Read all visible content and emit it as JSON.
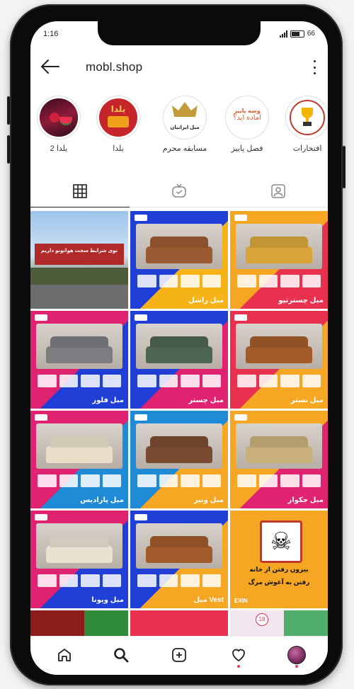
{
  "status": {
    "time": "1:16",
    "battery": "66"
  },
  "profile": {
    "username": "mobl.shop"
  },
  "highlights": [
    {
      "label": "افتخارات",
      "inner": "",
      "bg": "#ffffff",
      "accent": "#f2b400"
    },
    {
      "label": "فصل پاییز",
      "inner": "آماده اید؟",
      "inner_top": "وسه پاییز",
      "bg": "#ffffff",
      "accent": "#e0592b"
    },
    {
      "label": "مسابقه محرم",
      "inner": "مبل ایرانیان",
      "bg": "#ffffff",
      "accent": "#c49b3a"
    },
    {
      "label": "یلدا",
      "inner": "یلدا",
      "bg": "#c7252c",
      "accent": "#f2c94c"
    },
    {
      "label": "یلدا 2",
      "inner": "",
      "bg": "#8c1c3a",
      "accent": "#f0b429"
    }
  ],
  "tabs": [
    {
      "name": "grid-tab",
      "active": true
    },
    {
      "name": "reels-tab",
      "active": false
    },
    {
      "name": "tagged-tab",
      "active": false
    }
  ],
  "posts": [
    {
      "name": "",
      "colors": [
        "#2b6cb0",
        "#ffffff"
      ],
      "kind": "billboard",
      "caption": "نوی شرایط سخت هوانونو داریم"
    },
    {
      "name": "مبل راشل",
      "colors": [
        "#1f3fd6",
        "#f6b318"
      ],
      "sofa": "#9a5a32"
    },
    {
      "name": "مبل چسترتیو",
      "colors": [
        "#f5a623",
        "#e8304f"
      ],
      "sofa": "#d9a43a"
    },
    {
      "name": "مبل فلور",
      "colors": [
        "#e02370",
        "#1f3fd6"
      ],
      "sofa": "#7b7d80"
    },
    {
      "name": "مبل چستر",
      "colors": [
        "#1f3fd6",
        "#e02370"
      ],
      "sofa": "#4e6455"
    },
    {
      "name": "مبل نستر",
      "colors": [
        "#e8304f",
        "#f5a623"
      ],
      "sofa": "#a35b2a"
    },
    {
      "name": "مبل پارادیس",
      "colors": [
        "#e02370",
        "#1f8ad6"
      ],
      "sofa": "#e9dfc9"
    },
    {
      "name": "مبل ونیز",
      "colors": [
        "#1f8ad6",
        "#f5a623"
      ],
      "sofa": "#7a4b32"
    },
    {
      "name": "مبل جکوار",
      "colors": [
        "#f5a623",
        "#e02370"
      ],
      "sofa": "#c9b07a"
    },
    {
      "name": "مبل ویونا",
      "colors": [
        "#e02370",
        "#1f3fd6"
      ],
      "sofa": "#e8e2d2"
    },
    {
      "name": "مبل Vest",
      "colors": [
        "#1f3fd6",
        "#f5a623"
      ],
      "sofa": "#a15a2a"
    },
    {
      "name": "",
      "kind": "warning",
      "colors": [
        "#f5a623",
        "#f5a623"
      ],
      "line1": "بیرون رفتن از خانه",
      "line2": "رفتن به آغوش مرگ",
      "footer": "EXIN"
    },
    {
      "name": "",
      "kind": "partial",
      "colors": [
        "#8c1c1c",
        "#2f8a3a"
      ]
    },
    {
      "name": "",
      "kind": "partial",
      "colors": [
        "#e8304f",
        "#e8304f"
      ]
    },
    {
      "name": "",
      "kind": "partial",
      "colors": [
        "#f2e6f0",
        "#4fae6a"
      ],
      "badge": "18"
    }
  ],
  "colors": {
    "accent": "#e23a5a",
    "border": "#e6e6e6",
    "text": "#222222"
  }
}
